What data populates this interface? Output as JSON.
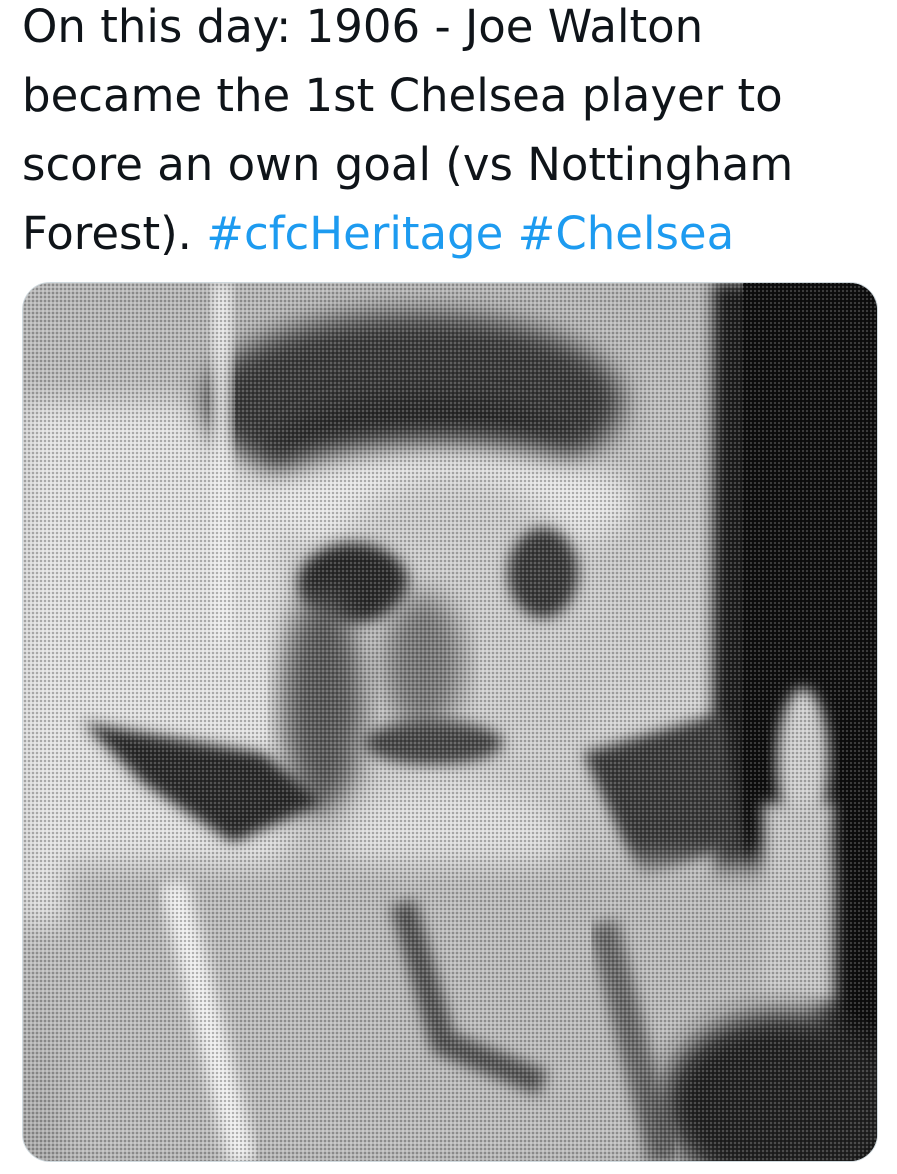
{
  "tweet": {
    "text_before": "On this day: 1906 - Joe Walton became the 1st Chelsea player to score an own goal (vs Nottingham Forest). ",
    "hashtags": [
      "#cfcHeritage",
      "#Chelsea"
    ],
    "hashtag_color": "#1d9bf0",
    "text_color": "#0f1419"
  },
  "media": {
    "kind": "black-and-white halftone photograph"
  }
}
